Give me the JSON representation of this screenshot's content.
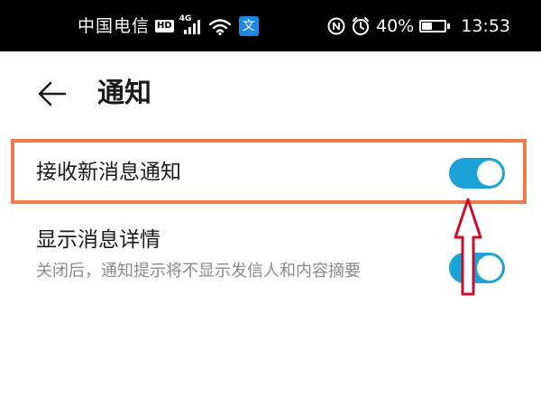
{
  "status_bar": {
    "carrier": "中国电信",
    "hd_badge": "HD",
    "network_type": "4G",
    "translate_badge": "文",
    "battery_percent": "40%",
    "battery_level": 0.4,
    "time": "13:53",
    "icons": [
      "hd-icon",
      "signal-icon",
      "wifi-icon",
      "translate-icon",
      "nfc-icon",
      "alarm-icon",
      "battery-icon"
    ]
  },
  "header": {
    "back_icon": "back-arrow-icon",
    "title": "通知"
  },
  "settings": {
    "new_message": {
      "label": "接收新消息通知",
      "enabled": true
    },
    "show_details": {
      "label": "显示消息详情",
      "description": "关闭后，通知提示将不显示发信人和内容摘要",
      "enabled": true
    }
  },
  "colors": {
    "toggle_on": "#1aa3d4",
    "highlight_border": "#f07a4a",
    "annotation_arrow": "#c8102e",
    "status_bar_bg": "#000000"
  }
}
